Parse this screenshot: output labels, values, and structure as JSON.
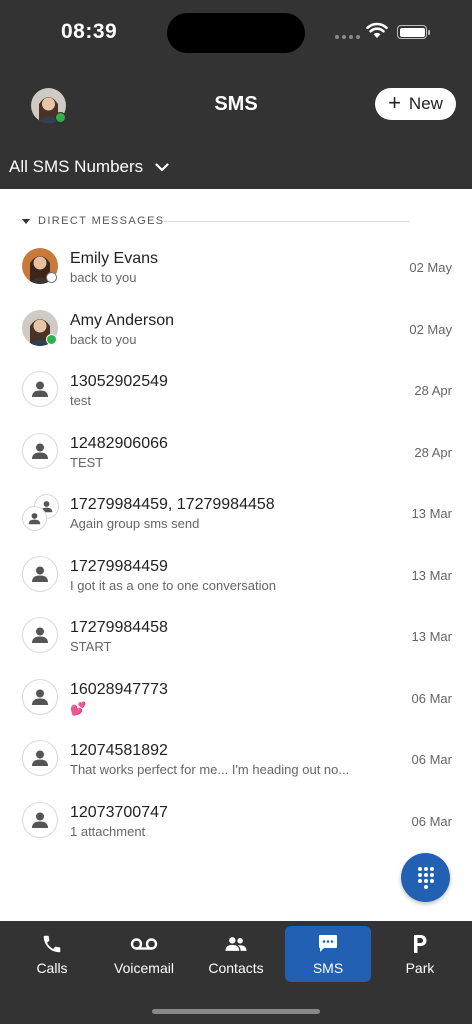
{
  "status_bar": {
    "time": "08:39",
    "battery_level": 1.0
  },
  "header": {
    "title": "SMS",
    "new_button": "New",
    "filter": "All SMS Numbers"
  },
  "section": {
    "label": "DIRECT MESSAGES"
  },
  "conversations": [
    {
      "name": "Emily Evans",
      "preview": "back to you",
      "date": "02 May",
      "avatar": "photo-emily",
      "presence": "offline"
    },
    {
      "name": "Amy Anderson",
      "preview": "back to you",
      "date": "02 May",
      "avatar": "photo-amy",
      "presence": "online"
    },
    {
      "name": "13052902549",
      "preview": "test",
      "date": "28 Apr",
      "avatar": "person-icon"
    },
    {
      "name": "12482906066",
      "preview": "TEST",
      "date": "28 Apr",
      "avatar": "person-icon"
    },
    {
      "name": "17279984459, 17279984458",
      "preview": "Again group sms send",
      "date": "13 Mar",
      "avatar": "group-icon"
    },
    {
      "name": "17279984459",
      "preview": "I got it as a one to one conversation",
      "date": "13 Mar",
      "avatar": "person-icon"
    },
    {
      "name": "17279984458",
      "preview": "START",
      "date": "13 Mar",
      "avatar": "person-icon"
    },
    {
      "name": "16028947773",
      "preview": "💕",
      "date": "06 Mar",
      "avatar": "person-icon"
    },
    {
      "name": "12074581892",
      "preview": "That works perfect for me... I'm heading out no...",
      "date": "06 Mar",
      "avatar": "person-icon"
    },
    {
      "name": "12073700747",
      "preview": "1 attachment",
      "date": "06 Mar",
      "avatar": "person-icon"
    }
  ],
  "tabs": [
    {
      "label": "Calls",
      "icon": "phone-icon",
      "active": false
    },
    {
      "label": "Voicemail",
      "icon": "voicemail-icon",
      "active": false
    },
    {
      "label": "Contacts",
      "icon": "contacts-icon",
      "active": false
    },
    {
      "label": "SMS",
      "icon": "chat-icon",
      "active": true
    },
    {
      "label": "Park",
      "icon": "park-icon",
      "active": false
    }
  ],
  "colors": {
    "header_bg": "#333333",
    "accent": "#2260b3",
    "online": "#2eb34a"
  }
}
